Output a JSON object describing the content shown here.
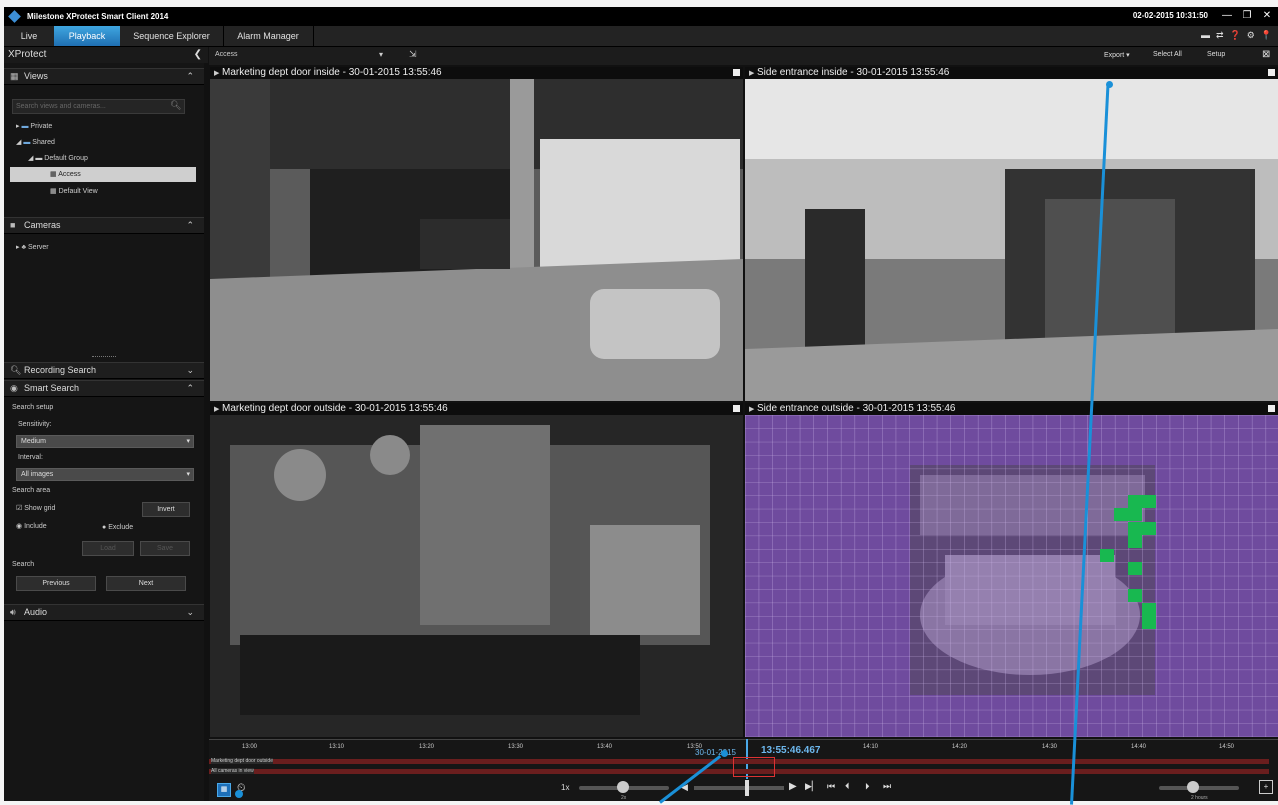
{
  "window": {
    "title": "Milestone XProtect Smart Client 2014",
    "datetime": "02-02-2015 10:31:50"
  },
  "tabs": [
    "Live",
    "Playback",
    "Sequence Explorer",
    "Alarm Manager"
  ],
  "active_tab": "Playback",
  "sidebar": {
    "header": "XProtect",
    "views": {
      "title": "Views",
      "search_placeholder": "Search views and cameras...",
      "items": [
        "Private",
        "Shared",
        "Default Group",
        "Access",
        "Default View"
      ],
      "selected": "Access"
    },
    "cameras": {
      "title": "Cameras",
      "items": [
        "Server"
      ]
    },
    "recording_search": "Recording Search",
    "smart_search": {
      "title": "Smart Search",
      "search_setup": "Search setup",
      "sensitivity_label": "Sensitivity:",
      "sensitivity_value": "Medium",
      "interval_label": "Interval:",
      "interval_value": "All images",
      "search_area": "Search area",
      "show_grid": "Show grid",
      "invert": "Invert",
      "include": "Include",
      "exclude": "Exclude",
      "load": "Load",
      "save": "Save",
      "search": "Search",
      "previous": "Previous",
      "next": "Next"
    },
    "audio": "Audio"
  },
  "toolbar": {
    "view_name": "Access",
    "export": "Export",
    "select_all": "Select All",
    "setup": "Setup"
  },
  "cameras": [
    {
      "title": "Marketing dept door inside - 30-01-2015 13:55:46"
    },
    {
      "title": "Side entrance inside - 30-01-2015 13:55:46"
    },
    {
      "title": "Marketing dept door outside - 30-01-2015 13:55:46"
    },
    {
      "title": "Side entrance outside - 30-01-2015 13:55:46"
    }
  ],
  "timeline": {
    "ticks": [
      "13:00",
      "13:10",
      "13:20",
      "13:30",
      "13:40",
      "13:50",
      "14:10",
      "14:20",
      "14:30",
      "14:40",
      "14:50"
    ],
    "date": "30-01-2015",
    "time": "13:55:46.467",
    "track1": "Marketing dept door outside",
    "track2": "All cameras in view",
    "speed": "1x",
    "speed_sub": "2x",
    "span": "2 hours"
  },
  "colors": {
    "accent": "#1a90d8",
    "grid_overlay": "#8a5cc4",
    "motion": "#18b850"
  },
  "icons": [
    "views-icon",
    "cameras-icon",
    "search-icon",
    "smart-search-icon",
    "audio-icon",
    "clock-icon",
    "play-icon",
    "help-icon",
    "gear-icon",
    "pin-icon"
  ]
}
